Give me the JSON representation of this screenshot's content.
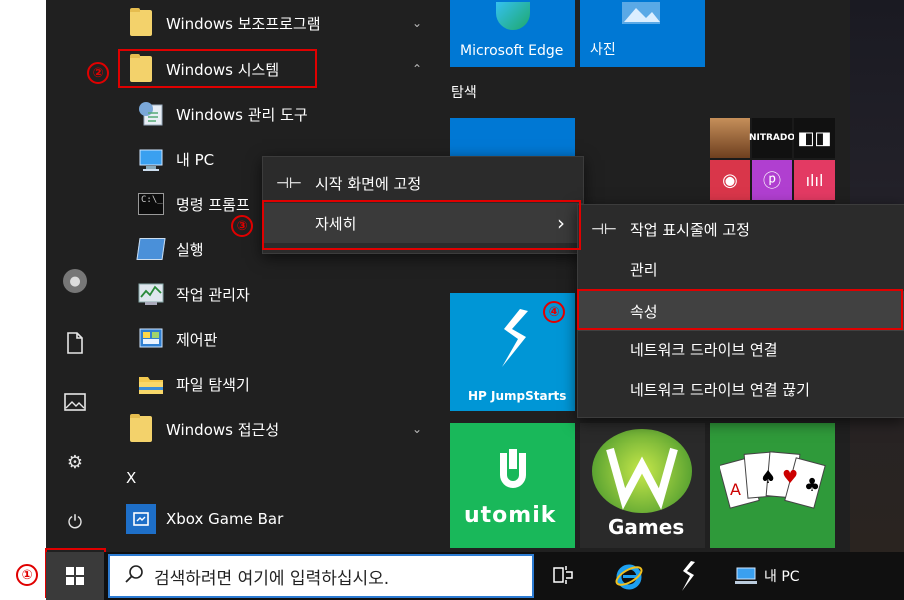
{
  "start_menu": {
    "app_list": [
      {
        "label": "Windows 보조프로그램",
        "chevron": "⌄"
      },
      {
        "label": "Windows 시스템",
        "chevron": "⌃"
      },
      {
        "label": "Windows 관리 도구"
      },
      {
        "label": "내 PC"
      },
      {
        "label": "명령 프롬프"
      },
      {
        "label": "실행"
      },
      {
        "label": "작업 관리자"
      },
      {
        "label": "제어판"
      },
      {
        "label": "파일 탐색기"
      },
      {
        "label": "Windows 접근성",
        "chevron": "⌄"
      },
      {
        "label": "X"
      },
      {
        "label": "Xbox Game Bar"
      }
    ],
    "tiles": {
      "group_label": "탐색",
      "edge": "Microsoft Edge",
      "photos": "사진",
      "hp": "HP JumpStarts",
      "utomik": "utomik",
      "games": "Games",
      "nitrado": "NITRADO"
    }
  },
  "context_menu": {
    "pin_start": "시작 화면에 고정",
    "more": "자세히",
    "more_arrow": "›"
  },
  "submenu": {
    "items": [
      "작업 표시줄에 고정",
      "관리",
      "속성",
      "네트워크 드라이브 연결",
      "네트워크 드라이브 연결 끊기"
    ]
  },
  "annotations": [
    "①",
    "②",
    "③",
    "④"
  ],
  "taskbar": {
    "search_placeholder": "검색하려면 여기에 입력하십시오.",
    "pinned_label": "내 PC"
  },
  "colors": {
    "accent_blue": "#0078d4",
    "annotation_red": "#e00000",
    "menu_bg": "#2b2b2b"
  }
}
